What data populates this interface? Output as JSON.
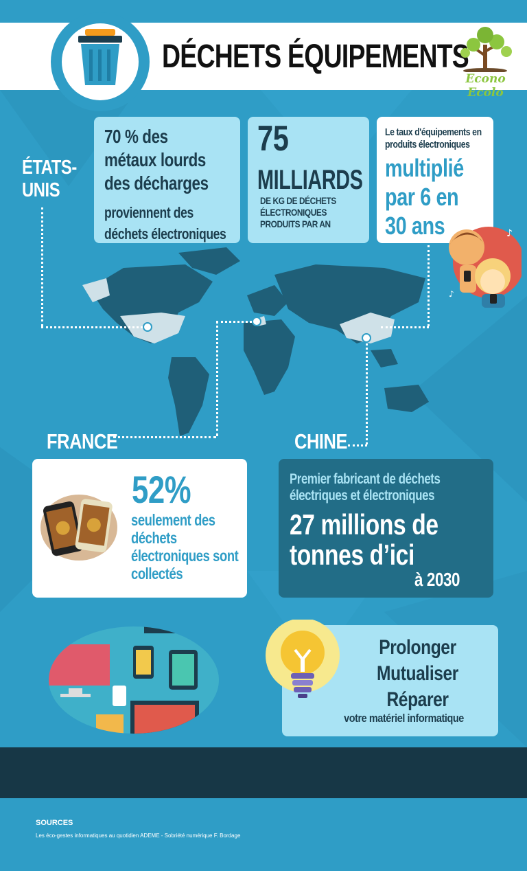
{
  "header": {
    "title": "DÉCHETS ÉQUIPEMENTS",
    "logo_text": "Econo Ecolo"
  },
  "usa": {
    "label_line1": "ÉTATS-",
    "label_line2": "UNIS",
    "card1": {
      "line1": "70 % des",
      "line2": "métaux lourds",
      "line3": "des décharges",
      "line4": "proviennent des",
      "line5": "déchets électroniques"
    },
    "card2": {
      "number": "75",
      "unit": "MILLIARDS",
      "line1": "DE KG DE DÉCHETS",
      "line2": "ÉLECTRONIQUES",
      "line3": "PRODUITS  PAR AN"
    },
    "card3": {
      "line1": "Le taux d'équipements en",
      "line2": "produits électroniques",
      "big1": "multiplié",
      "big2": "par 6 en",
      "big3": "30 ans"
    }
  },
  "france": {
    "label": "FRANCE",
    "percent": "52%",
    "line1": "seulement des",
    "line2": "déchets",
    "line3": "électroniques sont",
    "line4": "collectés"
  },
  "china": {
    "label": "CHINE",
    "line1": "Premier fabricant de déchets",
    "line2": "électriques et électroniques",
    "big1": "27 millions de",
    "big2": "tonnes d’ici",
    "year": "à 2030"
  },
  "tips": {
    "line1": "Prolonger",
    "line2": "Mutualiser",
    "line3": "Réparer",
    "line4": "votre matériel informatique"
  },
  "sources": {
    "title": "SOURCES",
    "text": "Les éco-gestes informatiques au quotidien ADEME - Sobriété numérique F. Bordage"
  },
  "colors": {
    "background": "#2f9dc6",
    "card_light": "#a9e3f4",
    "card_dark": "#226d87",
    "footer_band": "#173746",
    "accent_text": "#2f9dc6"
  }
}
